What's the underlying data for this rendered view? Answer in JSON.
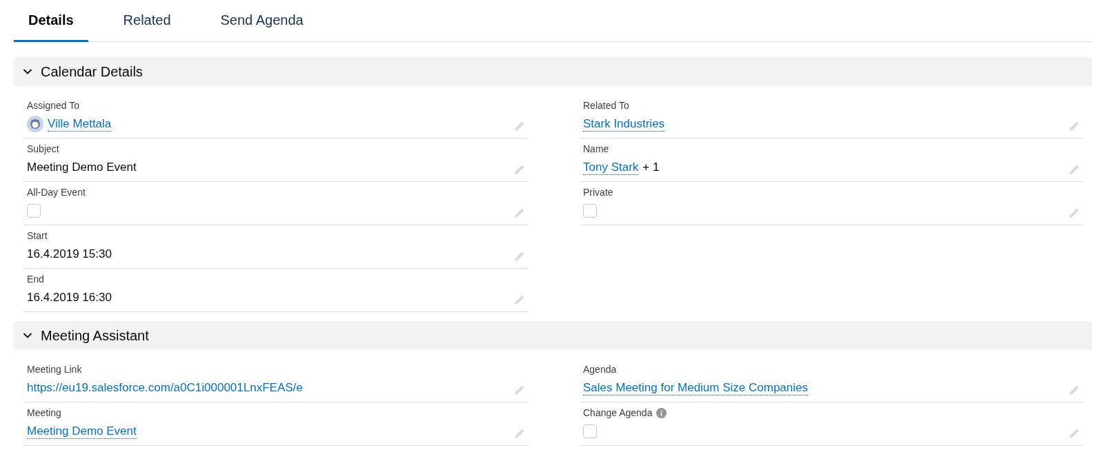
{
  "tabs": [
    {
      "label": "Details",
      "selected": true
    },
    {
      "label": "Related",
      "selected": false
    },
    {
      "label": "Send Agenda",
      "selected": false
    }
  ],
  "sections": [
    {
      "title": "Calendar Details",
      "expanded": true,
      "left": [
        {
          "label": "Assigned To",
          "kind": "user",
          "value": "Ville Mettala"
        },
        {
          "label": "Subject",
          "kind": "text",
          "value": "Meeting Demo Event"
        },
        {
          "label": "All-Day Event",
          "kind": "checkbox",
          "checked": false
        },
        {
          "label": "Start",
          "kind": "text",
          "value": "16.4.2019 15:30"
        },
        {
          "label": "End",
          "kind": "text",
          "value": "16.4.2019 16:30"
        }
      ],
      "right": [
        {
          "label": "Related To",
          "kind": "link",
          "value": "Stark Industries"
        },
        {
          "label": "Name",
          "kind": "link",
          "value": "Tony Stark",
          "extra": "+ 1"
        },
        {
          "label": "Private",
          "kind": "checkbox",
          "checked": false
        }
      ]
    },
    {
      "title": "Meeting Assistant",
      "expanded": true,
      "left": [
        {
          "label": "Meeting Link",
          "kind": "url",
          "value": "https://eu19.salesforce.com/a0C1i000001LnxFEAS/e"
        },
        {
          "label": "Meeting",
          "kind": "link",
          "value": "Meeting Demo Event"
        }
      ],
      "right": [
        {
          "label": "Agenda",
          "kind": "link",
          "value": "Sales Meeting for Medium Size Companies"
        },
        {
          "label": "Change Agenda",
          "kind": "checkbox",
          "checked": false,
          "info": true
        }
      ]
    }
  ]
}
